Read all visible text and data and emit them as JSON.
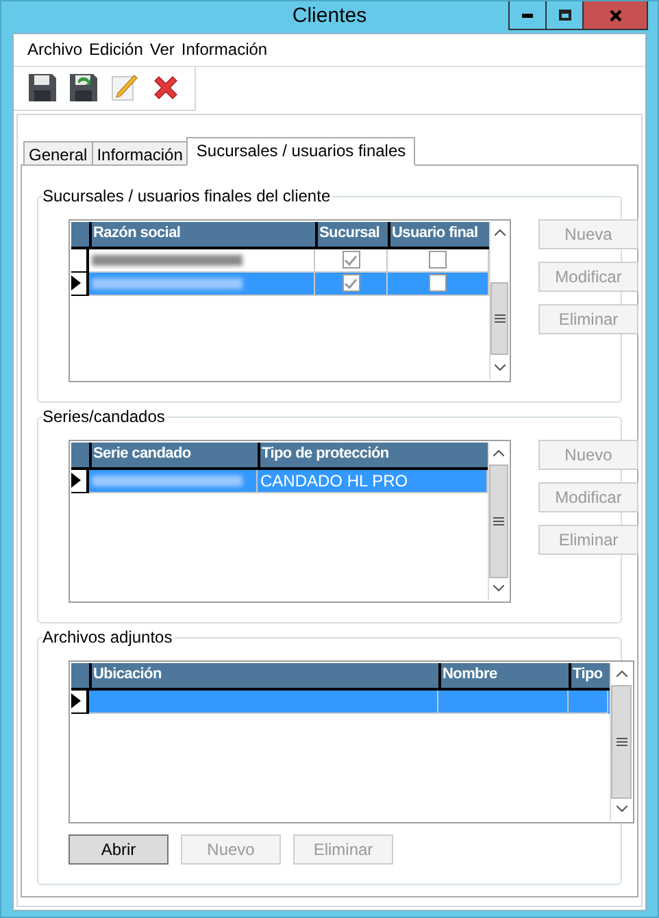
{
  "window": {
    "title": "Clientes"
  },
  "menu": [
    "Archivo",
    "Edición",
    "Ver",
    "Información"
  ],
  "toolbar": [
    {
      "kind": "save"
    },
    {
      "kind": "save-refresh"
    },
    {
      "kind": "edit"
    },
    {
      "kind": "delete"
    }
  ],
  "tabs": [
    {
      "label": "General",
      "selected": false
    },
    {
      "label": "Información",
      "selected": false
    },
    {
      "label": "Sucursales / usuarios finales",
      "selected": true
    }
  ],
  "groups": [
    {
      "title": "Sucursales / usuarios finales del cliente",
      "kind": "side-buttons",
      "grid": {
        "columns": [
          "Razón social",
          "Sucursal",
          "Usuario final"
        ],
        "rows": [
          {
            "selected": false,
            "cells": [
              {
                "kind": "blurred"
              },
              {
                "kind": "check",
                "checked": true
              },
              {
                "kind": "check",
                "checked": false
              }
            ]
          },
          {
            "selected": true,
            "cells": [
              {
                "kind": "blurred"
              },
              {
                "kind": "check",
                "checked": true
              },
              {
                "kind": "check",
                "checked": false
              }
            ]
          }
        ]
      },
      "buttons": [
        {
          "label": "Nueva",
          "disabled": true
        },
        {
          "label": "Modificar",
          "disabled": true
        },
        {
          "label": "Eliminar",
          "disabled": true
        }
      ]
    },
    {
      "title": "Series/candados",
      "kind": "side-buttons",
      "grid": {
        "columns": [
          "Serie candado",
          "Tipo de protección"
        ],
        "rows": [
          {
            "selected": true,
            "cells": [
              {
                "kind": "blurred"
              },
              {
                "kind": "text",
                "text": "CANDADO HL PRO"
              }
            ]
          }
        ]
      },
      "buttons": [
        {
          "label": "Nuevo",
          "disabled": true
        },
        {
          "label": "Modificar",
          "disabled": true
        },
        {
          "label": "Eliminar",
          "disabled": true
        }
      ]
    },
    {
      "title": "Archivos adjuntos",
      "kind": "bottom-buttons",
      "grid": {
        "columns": [
          "Ubicación",
          "Nombre",
          "Tipo"
        ],
        "rows": [
          {
            "selected": true,
            "cells": [
              {
                "kind": "empty"
              },
              {
                "kind": "empty"
              },
              {
                "kind": "empty"
              }
            ]
          }
        ]
      },
      "buttons": [
        {
          "label": "Abrir",
          "disabled": false
        },
        {
          "label": "Nuevo",
          "disabled": true
        },
        {
          "label": "Eliminar",
          "disabled": true
        }
      ]
    }
  ]
}
